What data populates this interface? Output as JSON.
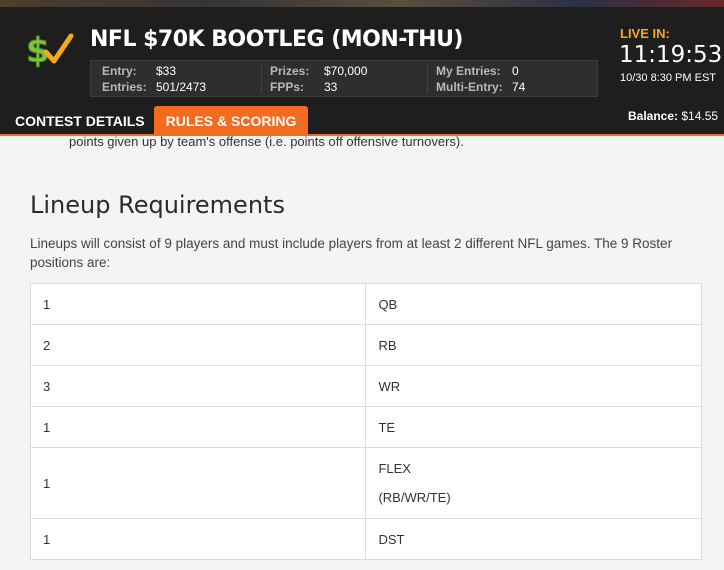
{
  "contest": {
    "title": "NFL $70K BOOTLEG (MON-THU)",
    "entry_label": "Entry:",
    "entry_value": "$33",
    "entries_label": "Entries:",
    "entries_value": "501/2473",
    "prizes_label": "Prizes:",
    "prizes_value": "$70,000",
    "fpps_label": "FPPs:",
    "fpps_value": "33",
    "my_entries_label": "My Entries:",
    "my_entries_value": "0",
    "multi_entry_label": "Multi-Entry:",
    "multi_entry_value": "74"
  },
  "live": {
    "label": "LIVE IN:",
    "countdown": "11:19:53",
    "start_time": "10/30 8:30 PM EST"
  },
  "balance": {
    "label": "Balance:",
    "value": "$14.55"
  },
  "tabs": [
    {
      "label": "CONTEST DETAILS",
      "active": false
    },
    {
      "label": "RULES & SCORING",
      "active": true
    }
  ],
  "content": {
    "prev_text": "points given up by team's offense (i.e. points off offensive turnovers).",
    "heading": "Lineup Requirements",
    "intro": "Lineups will consist of 9 players and must include players from at least 2 different NFL games. The 9 Roster positions are:",
    "roster": [
      {
        "count": "1",
        "position": "QB"
      },
      {
        "count": "2",
        "position": "RB"
      },
      {
        "count": "3",
        "position": "WR"
      },
      {
        "count": "1",
        "position": "TE"
      },
      {
        "count": "1",
        "position": "FLEX",
        "sub": "(RB/WR/TE)"
      },
      {
        "count": "1",
        "position": "DST"
      }
    ]
  },
  "colors": {
    "accent_orange": "#f26b21",
    "live_yellow": "#f7a81b",
    "header_bg": "#1e1e1e",
    "logo_green": "#7dc242"
  },
  "icons": [
    "dollar-check-logo-icon"
  ]
}
